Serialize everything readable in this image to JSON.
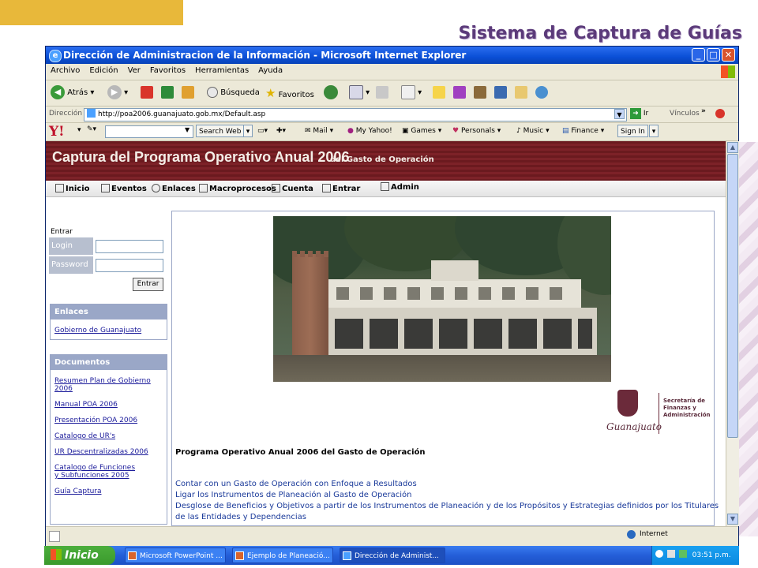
{
  "slide": {
    "title": "Sistema de Captura de Guías"
  },
  "window": {
    "title": "Dirección de Administracion de la Información - Microsoft Internet Explorer",
    "buttons": {
      "minimize": "_",
      "maximize": "□",
      "close": "✕"
    }
  },
  "menu": {
    "items": [
      "Archivo",
      "Edición",
      "Ver",
      "Favoritos",
      "Herramientas",
      "Ayuda"
    ]
  },
  "toolbar": {
    "back_label": "Atrás",
    "search_label": "Búsqueda",
    "favorites_label": "Favoritos"
  },
  "address": {
    "label": "Dirección",
    "url": "http://poa2006.guanajuato.gob.mx/Default.asp",
    "go_label": "Ir",
    "links_label": "Vínculos"
  },
  "yahoo_bar": {
    "search_button": "Search Web",
    "mail": "Mail",
    "my_yahoo": "My Yahoo!",
    "games": "Games",
    "personals": "Personals",
    "music": "Music",
    "finance": "Finance",
    "sign_in": "Sign In"
  },
  "site": {
    "header_title": "Captura del Programa Operativo Anual 2006",
    "header_subtitle": "del Gasto de Operación",
    "nav": [
      "Inicio",
      "Eventos",
      "Enlaces",
      "Macroprocesos",
      "Cuenta",
      "Entrar",
      "Admin"
    ]
  },
  "login": {
    "heading": "Entrar",
    "login_label": "Login",
    "password_label": "Password",
    "submit_label": "Entrar"
  },
  "enlaces": {
    "heading": "Enlaces",
    "links": [
      "Gobierno de Guanajuato"
    ]
  },
  "documentos": {
    "heading": "Documentos",
    "links": [
      "Resumen Plan de Gobierno 2006",
      "Manual POA 2006",
      "Presentación POA 2006",
      "Catalogo de UR's",
      "UR Descentralizadas 2006",
      "Catalogo de Funciones y Subfunciones 2005",
      "Guía Captura"
    ]
  },
  "main": {
    "logo_left": "Guanajuato",
    "logo_right": "Secretaría de Finanzas y Administración",
    "program_title": "Programa Operativo Anual 2006 del Gasto de Operación",
    "links": [
      "Contar con un Gasto de Operación con Enfoque a Resultados",
      "Ligar los Instrumentos de Planeación al Gasto de Operación",
      "Desglose de Beneficios y Objetivos a partir de los Instrumentos de Planeación y de los Propósitos y Estrategias definidos por los Titulares",
      "de las Entidades y Dependencias"
    ]
  },
  "status": {
    "zone": "Internet"
  },
  "taskbar": {
    "start_label": "Inicio",
    "items": [
      "Microsoft PowerPoint ...",
      "Ejemplo de Planeació...",
      "Dirección de Administ..."
    ],
    "clock": "03:51 p.m."
  }
}
